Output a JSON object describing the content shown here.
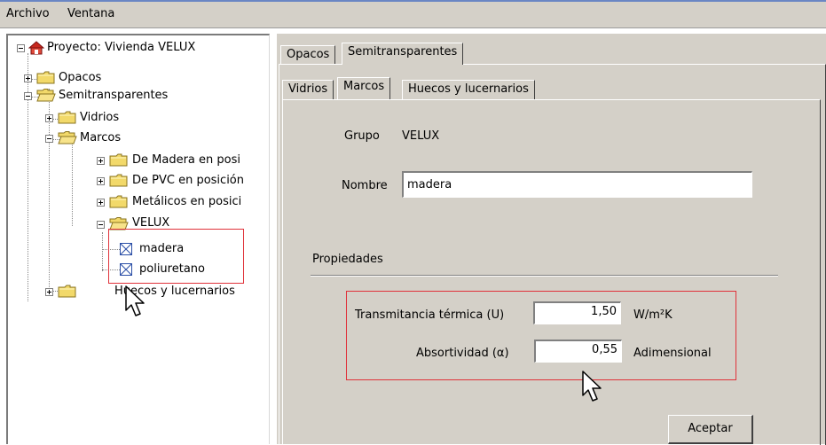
{
  "menu": {
    "archivo": "Archivo",
    "ventana": "Ventana"
  },
  "tree": {
    "root": "Proyecto: Vivienda VELUX",
    "opacos": "Opacos",
    "semitransparentes": "Semitransparentes",
    "vidrios": "Vidrios",
    "marcos": "Marcos",
    "madera_posicion": "De Madera en posi",
    "pvc_posicion": "De PVC en posición",
    "metalicos_posicion": "Metálicos en posici",
    "velux": "VELUX",
    "madera": "madera",
    "poliuretano": "poliuretano",
    "huecos": "Huecos y lucernarios"
  },
  "tabs": {
    "opacos": "Opacos",
    "semitransparentes": "Semitransparentes",
    "vidrios": "Vidrios",
    "marcos": "Marcos",
    "huecos": "Huecos y lucernarios"
  },
  "form": {
    "grupo_label": "Grupo",
    "grupo_value": "VELUX",
    "nombre_label": "Nombre",
    "nombre_value": "madera",
    "propiedades": "Propiedades",
    "transmitancia_label": "Transmitancia térmica (U)",
    "transmitancia_value": "1,50",
    "transmitancia_unit": "W/m²K",
    "absortividad_label": "Absortividad (α)",
    "absortividad_value": "0,55",
    "absortividad_unit": "Adimensional",
    "aceptar": "Aceptar"
  },
  "colors": {
    "highlight_box": "#e0323a",
    "window_face": "#d4d0c8",
    "folder_yellow": "#f2d96a"
  }
}
